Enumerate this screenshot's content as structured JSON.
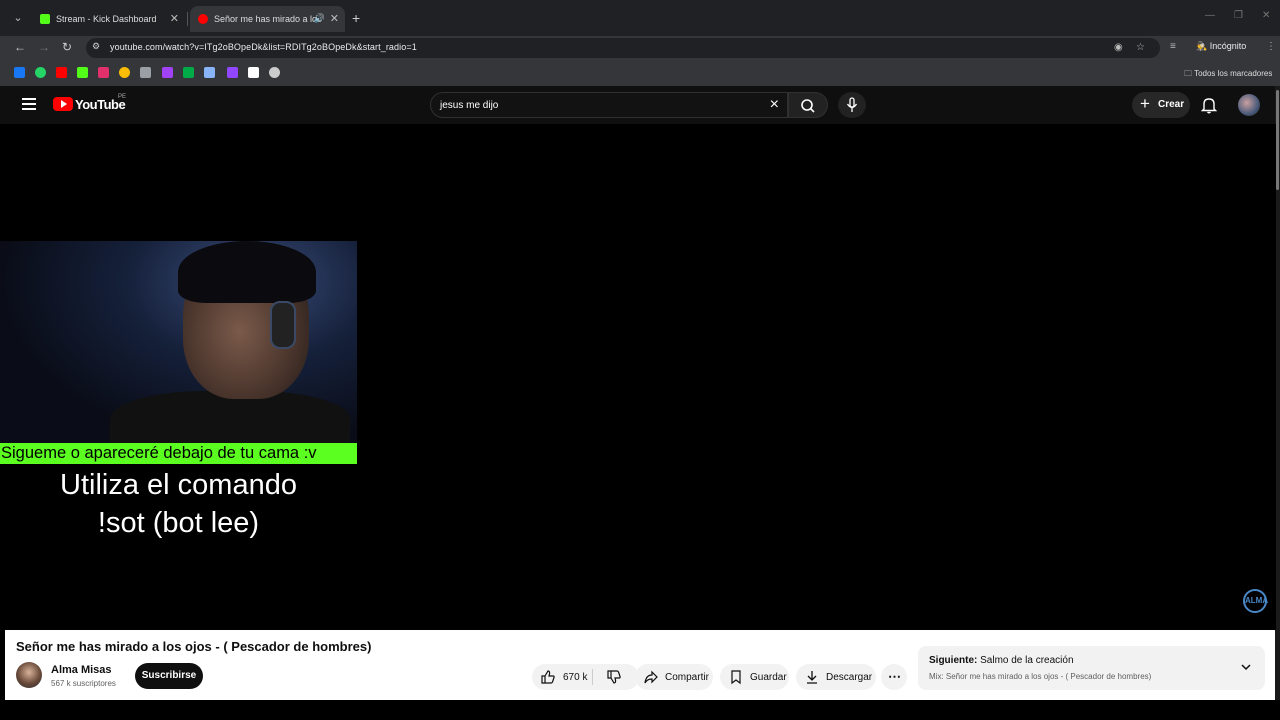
{
  "browser": {
    "tabs": [
      {
        "title": "Stream - Kick Dashboard",
        "favicon_color": "#53fc18"
      },
      {
        "title": "Señor me has mirado a los",
        "favicon_color": "#ff0000"
      }
    ],
    "url": "youtube.com/watch?v=ITg2oBOpeDk&list=RDITg2oBOpeDk&start_radio=1",
    "incognito_label": "Incógnito",
    "bookmarks_label": "Todos los marcadores",
    "bookmark_icons": [
      {
        "name": "facebook-icon",
        "color": "#1877f2"
      },
      {
        "name": "whatsapp-icon",
        "color": "#25d366"
      },
      {
        "name": "youtube-icon",
        "color": "#ff0000"
      },
      {
        "name": "kick-icon",
        "color": "#53fc18"
      },
      {
        "name": "instagram-icon",
        "color": "#e1306c"
      },
      {
        "name": "chrome-icon",
        "color": "#fbbc05"
      },
      {
        "name": "generic-icon",
        "color": "#9aa0a6"
      },
      {
        "name": "app-icon",
        "color": "#a142f4"
      },
      {
        "name": "meet-icon",
        "color": "#00ac47"
      },
      {
        "name": "puzzle-icon",
        "color": "#8ab4f8"
      },
      {
        "name": "twitch-icon",
        "color": "#9146ff"
      },
      {
        "name": "tiktok-icon",
        "color": "#ffffff"
      },
      {
        "name": "openai-icon",
        "color": "#cccccc"
      }
    ]
  },
  "youtube": {
    "logo_text": "YouTube",
    "country": "PE",
    "search_query": "jesus me dijo",
    "create_label": "Crear"
  },
  "video": {
    "overlay_banner": "Sigueme o apareceré debajo de tu cama :v",
    "overlay_line1": "Utiliza el comando",
    "overlay_line2": "!sot (bot lee)",
    "watermark": "ALMA"
  },
  "info": {
    "title": "Señor me has mirado a los ojos - ( Pescador de hombres)",
    "channel_name": "Alma Misas",
    "subscribers": "567 k suscriptores",
    "subscribe_label": "Suscribirse",
    "likes": "670 k",
    "share_label": "Compartir",
    "save_label": "Guardar",
    "download_label": "Descargar",
    "next_prefix": "Siguiente:",
    "next_title": "Salmo de la creación",
    "next_mix": "Mix: Señor me has mirado a los ojos - ( Pescador de hombres)"
  }
}
